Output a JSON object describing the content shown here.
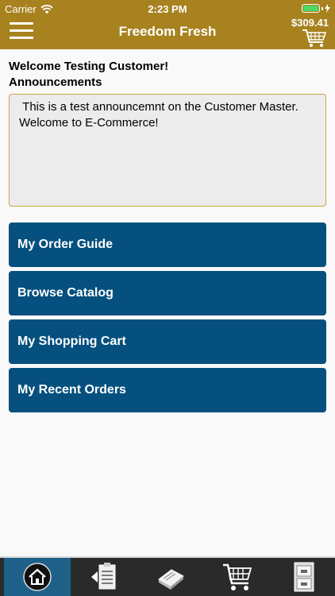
{
  "status_bar": {
    "carrier": "Carrier",
    "time": "2:23 PM"
  },
  "header": {
    "title": "Freedom Fresh",
    "cart_total": "$309.41",
    "background_color": "#a7821f"
  },
  "main": {
    "welcome_text": "Welcome Testing Customer!",
    "announcements_heading": "Announcements",
    "announcement_text": " This is a test announcemnt on the Customer Master.  Welcome to E-Commerce!"
  },
  "nav_buttons": [
    {
      "label": "My Order Guide"
    },
    {
      "label": "Browse Catalog"
    },
    {
      "label": "My Shopping Cart"
    },
    {
      "label": "My Recent Orders"
    }
  ],
  "nav_button_color": "#05507e",
  "tab_bar": {
    "active_index": 0,
    "tabs": [
      {
        "icon": "home-icon"
      },
      {
        "icon": "order-guide-icon"
      },
      {
        "icon": "catalog-icon"
      },
      {
        "icon": "shopping-cart-icon"
      },
      {
        "icon": "recent-orders-icon"
      }
    ]
  }
}
